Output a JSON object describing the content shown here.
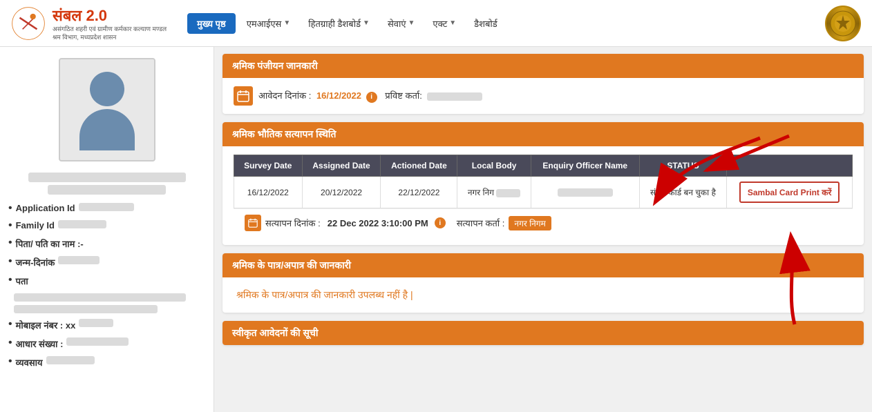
{
  "header": {
    "logo_title": "संबल 2.0",
    "logo_subtitle_line1": "असंगठित शहरी एवं ग्रामीण कर्मकार कल्याण मण्डल",
    "logo_subtitle_line2": "श्रम विभाग, मध्यप्रदेश शासन",
    "nav": {
      "main_page": "मुख्य पृष्ठ",
      "mains": "एमआईएस",
      "beneficiary": "हितग्राही डैशबोर्ड",
      "services": "सेवाएं",
      "act": "एक्ट",
      "dashboard": "डैशबोर्ड"
    }
  },
  "sidebar": {
    "info_items": [
      {
        "label": "Application Id",
        "value": ""
      },
      {
        "label": "Family Id",
        "value": ""
      },
      {
        "label": "पिता/ पति का नाम :-",
        "value": ""
      },
      {
        "label": "जन्म-दिनांक",
        "value": ""
      },
      {
        "label": "पता",
        "value": ""
      },
      {
        "label": "मोबाइल नंबर : xx",
        "value": ""
      },
      {
        "label": "आधार संख्या :",
        "value": ""
      },
      {
        "label": "व्यवसाय",
        "value": ""
      }
    ]
  },
  "registration": {
    "section_title": "श्रमिक पंजीयन जानकारी",
    "date_label": "आवेदन दिनांक :",
    "date_value": "16/12/2022",
    "entry_label": "प्रविष्ट कर्ता:",
    "entry_value": ""
  },
  "verification": {
    "section_title": "श्रमिक भौतिक सत्यापन स्थिति",
    "table_headers": [
      "Survey Date",
      "Assigned Date",
      "Actioned Date",
      "Local Body",
      "Enquiry Officer Name",
      "STATUS"
    ],
    "table_rows": [
      {
        "survey_date": "16/12/2022",
        "assigned_date": "20/12/2022",
        "actioned_date": "22/12/2022",
        "local_body": "नगर निग",
        "officer_name": "",
        "status": "संबल कार्ड बन चुका है",
        "action_btn": "Sambal Card Print करें"
      }
    ],
    "satyapan_date_label": "सत्यापन दिनांक :",
    "satyapan_date_value": "22 Dec 2022 3:10:00 PM",
    "satyapan_karta_label": "सत्यापन कर्ता :",
    "satyapan_karta_value": "नगर निगम"
  },
  "eligibility": {
    "section_title": "श्रमिक के पात्र/अपात्र की जानकारी",
    "message": "श्रमिक के पात्र/अपात्र की जानकारी उपलब्ध नहीं है |"
  },
  "accepted": {
    "section_title": "स्वीकृत आवेदनों की सूची"
  },
  "icons": {
    "calendar": "📅",
    "info": "i",
    "dropdown_arrow": "▼"
  }
}
